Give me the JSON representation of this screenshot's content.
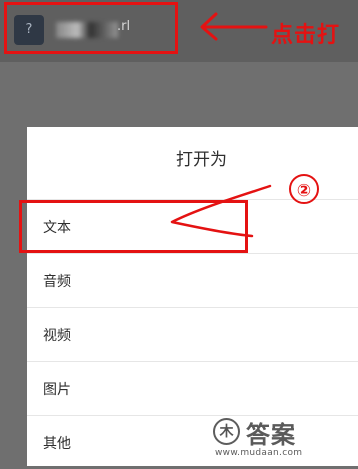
{
  "file": {
    "icon_glyph": "?",
    "name_tail": ".rl"
  },
  "annotations": {
    "click_label": "点击打",
    "step_number": "②",
    "accent_color": "#e41212"
  },
  "dialog": {
    "title": "打开为",
    "items": [
      {
        "label": "文本"
      },
      {
        "label": "音频"
      },
      {
        "label": "视频"
      },
      {
        "label": "图片"
      },
      {
        "label": "其他"
      }
    ]
  },
  "watermark": {
    "glyph": "木",
    "title": "答案",
    "url": "www.mudaan.com"
  }
}
